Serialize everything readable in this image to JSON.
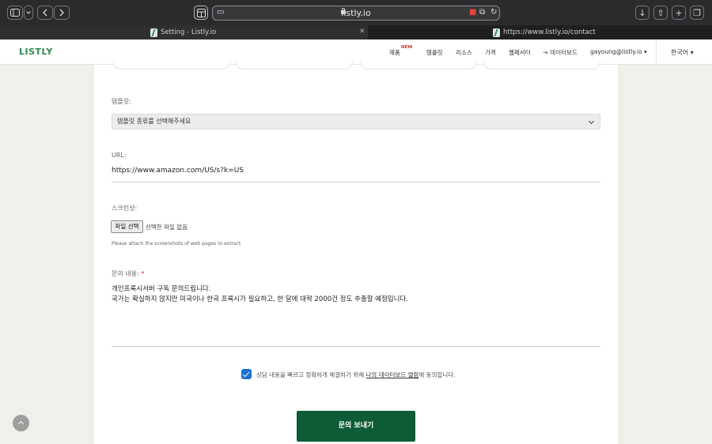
{
  "browser": {
    "host": "listly.io",
    "tabs": [
      {
        "title": "Setting - Listly.io",
        "active": true
      },
      {
        "title": "https://www.listly.io/contact",
        "active": false
      }
    ],
    "icons": [
      "sidebar-icon",
      "chevron-down-icon",
      "back-icon",
      "forward-icon",
      "tab-overview-icon",
      "lock-icon",
      "camera-icon",
      "translate-icon",
      "reload-icon",
      "download-icon",
      "share-icon",
      "new-tab-icon",
      "tabs-icon"
    ]
  },
  "nav": {
    "logo": "LISTLY",
    "items": [
      "제품",
      "템플릿",
      "리소스",
      "가격",
      "웹페서터",
      "데이터보드"
    ],
    "new_badge": "NEW",
    "user": "gayoung@listly.io ▾",
    "language": "한국어 ▾"
  },
  "form": {
    "template_label": "템플릿:",
    "template_value": "템플릿 종류를 선택해주세요",
    "url_label": "URL:",
    "url_value": "https://www.amazon.com/US/s?k=US",
    "screenshot_label": "스크린샷:",
    "file_button": "파일 선택",
    "file_none": "선택한 파일 없음",
    "file_help": "Please attach the screenshots of web pages to extract",
    "message_label": "문의 내용:",
    "required_mark": "*",
    "message_line1": "개인프록시서버 구독 문의드립니다.",
    "message_line2": "국가는 확실하지 않지만 미국이나 한국 프록시가 필요하고, 한 달에 대략 2000건 정도 추출할 예정입니다.",
    "consent_checked": true,
    "consent_pre": "상담 내용을 빠르고 정확하게 해결하기 위해 ",
    "consent_link": "나의 데이터보드 열람",
    "consent_post": "에 동의합니다.",
    "submit": "문의 보내기"
  },
  "colors": {
    "accent": "#0d5c36",
    "logo": "#2c8a4e",
    "checkbox": "#1d6fd1",
    "page_bg": "#f1efe9"
  }
}
